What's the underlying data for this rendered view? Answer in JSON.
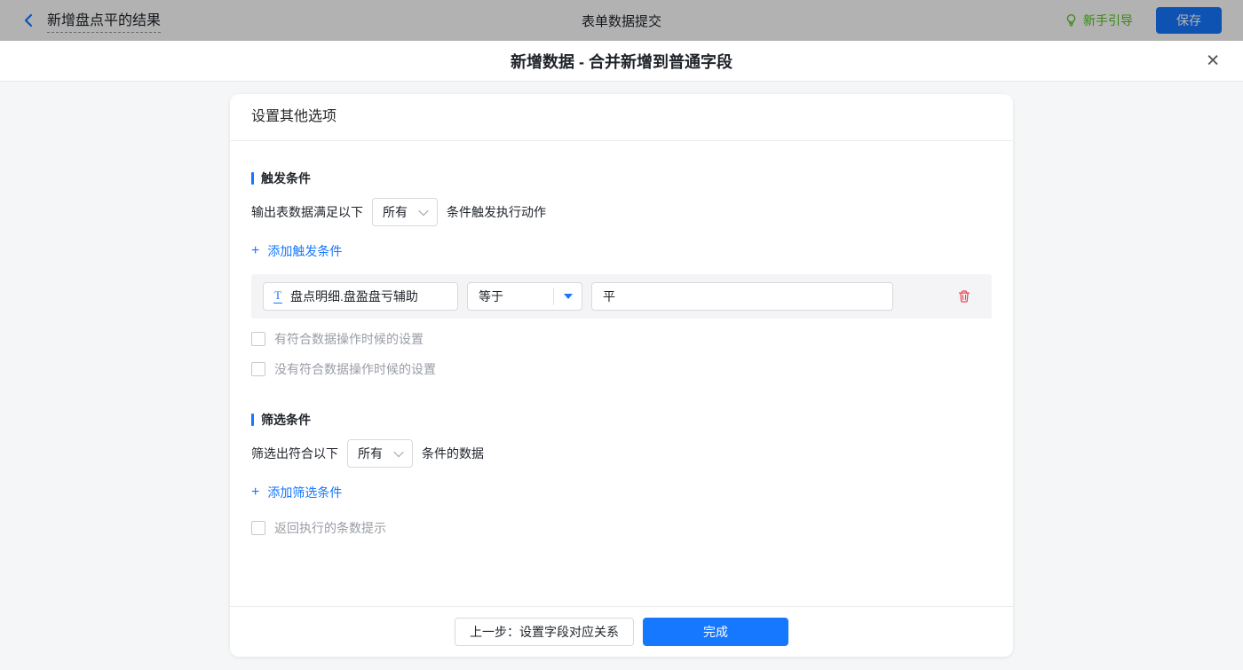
{
  "topbar": {
    "back_label": "新增盘点平的结果",
    "center_title": "表单数据提交",
    "guide_label": "新手引导",
    "save_label": "保存"
  },
  "modal": {
    "title": "新增数据 - 合并新增到普通字段"
  },
  "icons": {
    "plus": "+",
    "close": "✕",
    "field_type": "T"
  },
  "card": {
    "header": "设置其他选项",
    "trigger": {
      "title": "触发条件",
      "prefix": "输出表数据满足以下",
      "select_value": "所有",
      "suffix": "条件触发执行动作",
      "add_label": "添加触发条件",
      "condition": {
        "field": "盘点明细.盘盈盘亏辅助",
        "operator": "等于",
        "value": "平"
      },
      "checkboxes": [
        "有符合数据操作时候的设置",
        "没有符合数据操作时候的设置"
      ]
    },
    "filter": {
      "title": "筛选条件",
      "prefix": "筛选出符合以下",
      "select_value": "所有",
      "suffix": "条件的数据",
      "add_label": "添加筛选条件",
      "checkboxes": [
        "返回执行的条数提示"
      ]
    },
    "footer": {
      "prev_label": "上一步：设置字段对应关系",
      "done_label": "完成"
    }
  },
  "colors": {
    "accent_blue": "#1677ff",
    "guide_green": "#52c41a",
    "danger_red": "#e6434f"
  }
}
